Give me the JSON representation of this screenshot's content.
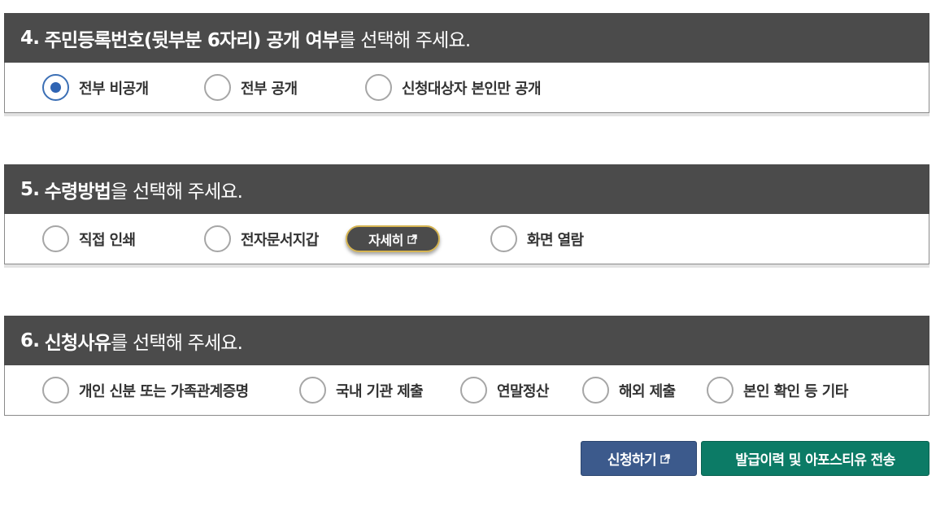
{
  "sections": [
    {
      "number": "4.",
      "highlight": "주민등록번호(뒷부분 6자리) 공개 여부",
      "rest": "를 선택해 주세요.",
      "options": [
        {
          "label": "전부 비공개",
          "checked": true
        },
        {
          "label": "전부 공개",
          "checked": false
        },
        {
          "label": "신청대상자 본인만 공개",
          "checked": false
        }
      ]
    },
    {
      "number": "5.",
      "highlight": "수령방법",
      "rest": "을 선택해 주세요.",
      "options": [
        {
          "label": "직접 인쇄",
          "checked": false
        },
        {
          "label": "전자문서지갑",
          "checked": false
        },
        {
          "label": "화면 열람",
          "checked": false
        }
      ],
      "detail_button": {
        "label": "자세히",
        "icon": "external-link-icon"
      }
    },
    {
      "number": "6.",
      "highlight": "신청사유",
      "rest": "를 선택해 주세요.",
      "options": [
        {
          "label": "개인 신분 또는 가족관계증명",
          "checked": false
        },
        {
          "label": "국내 기관 제출",
          "checked": false
        },
        {
          "label": "연말정산",
          "checked": false
        },
        {
          "label": "해외 제출",
          "checked": false
        },
        {
          "label": "본인 확인 등 기타",
          "checked": false
        }
      ]
    }
  ],
  "buttons": {
    "apply": {
      "label": "신청하기",
      "icon": "external-link-icon",
      "color": "#3c5a8c"
    },
    "send": {
      "label": "발급이력 및 아포스티유 전송",
      "color": "#0c7b66"
    }
  },
  "colors": {
    "header_bg": "#4b4b4b",
    "radio_checked": "#2f64b3",
    "detail_border": "#d6b552"
  }
}
